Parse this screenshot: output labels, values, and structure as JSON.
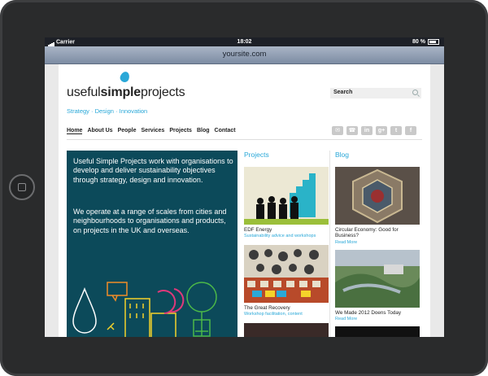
{
  "device": {
    "status": {
      "carrier": "Carrier",
      "time": "18:02",
      "battery": "80 %"
    },
    "url": "yoursite.com"
  },
  "site": {
    "logo": {
      "part1": "useful",
      "part2": "simple",
      "part3": "projects"
    },
    "tagline": "Strategy · Design · Innovation",
    "search_label": "Search",
    "nav": [
      "Home",
      "About Us",
      "People",
      "Services",
      "Projects",
      "Blog",
      "Contact"
    ],
    "social_icons": [
      "mail-icon",
      "phone-icon",
      "linkedin-icon",
      "google-plus-icon",
      "twitter-icon",
      "facebook-icon"
    ],
    "intro": {
      "p1": "Useful Simple Projects work with organisations to develop and deliver sustainability objectives through strategy, design and innovation.",
      "p2": "We operate at a range of scales from cities and neighbourhoods to organisations and products, on projects in the UK and overseas."
    },
    "projects": {
      "heading": "Projects",
      "items": [
        {
          "title": "EDF Energy",
          "sub": "Sustainability advice and workshops"
        },
        {
          "title": "The Great Recovery",
          "sub": "Workshop facilitation, content"
        }
      ]
    },
    "blog": {
      "heading": "Blog",
      "items": [
        {
          "title": "Circular Economy: Good for Business?",
          "more": "Read More"
        },
        {
          "title": "We Made 2012 Doens Today",
          "more": "Read More"
        }
      ]
    }
  },
  "colors": {
    "accent": "#2aa8d8",
    "panel": "#0c4a5a"
  }
}
